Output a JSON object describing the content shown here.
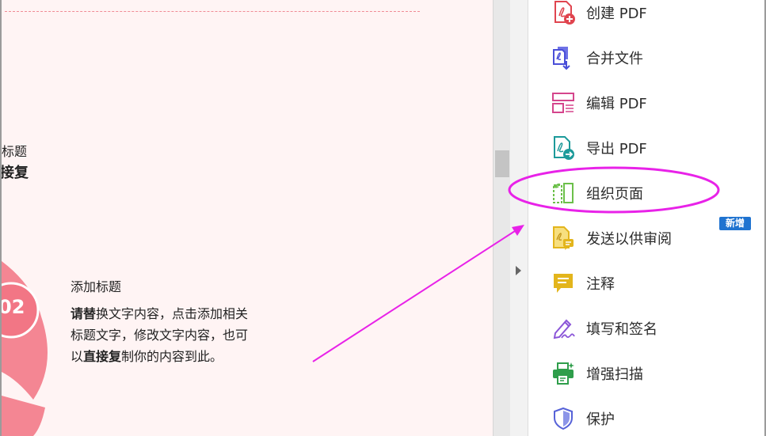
{
  "document": {
    "clipped_text_1": "标题",
    "clipped_text_2": "接复",
    "badge_number": "02",
    "section_title": "添加标题",
    "section_body": {
      "line1_bold": "请替",
      "line1_rest": "换文字内容，点击添加相关",
      "line2": "标题文字，修改文字内容，也可",
      "line3_pre": "以",
      "line3_bold": "直接复",
      "line3_rest": "制你的内容到此。"
    }
  },
  "tools": {
    "items": [
      {
        "label": "创建 PDF",
        "icon": "create-pdf-icon",
        "color": "#e0454f"
      },
      {
        "label": "合并文件",
        "icon": "combine-files-icon",
        "color": "#4a4fd8"
      },
      {
        "label": "编辑 PDF",
        "icon": "edit-pdf-icon",
        "color": "#d5458c"
      },
      {
        "label": "导出 PDF",
        "icon": "export-pdf-icon",
        "color": "#1c9a9a"
      },
      {
        "label": "组织页面",
        "icon": "organize-pages-icon",
        "color": "#6cc04a"
      },
      {
        "label": "发送以供审阅",
        "icon": "send-for-review-icon",
        "color": "#e3b51c"
      },
      {
        "label": "注释",
        "icon": "comment-icon",
        "color": "#e3b51c"
      },
      {
        "label": "填写和签名",
        "icon": "fill-sign-icon",
        "color": "#8b56d8"
      },
      {
        "label": "增强扫描",
        "icon": "enhance-scan-icon",
        "color": "#2f9e4b"
      },
      {
        "label": "保护",
        "icon": "protect-icon",
        "color": "#5662d8"
      }
    ],
    "new_badge": "新增"
  },
  "annotation_color": "#e822e8"
}
